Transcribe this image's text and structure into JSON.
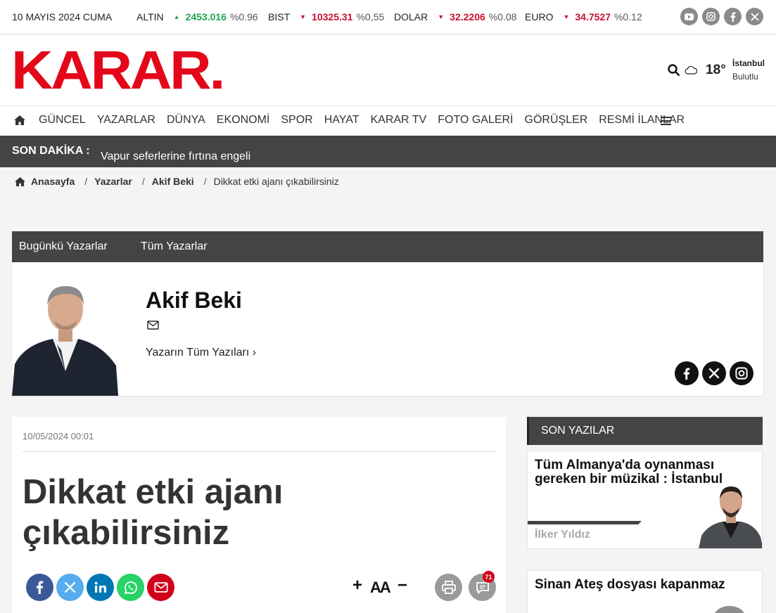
{
  "topbar": {
    "date": "10 MAYIS 2024 CUMA",
    "markets": [
      {
        "name": "ALTIN",
        "direction": "up",
        "value": "2453.016",
        "change": "%0.96"
      },
      {
        "name": "BIST",
        "direction": "down",
        "value": "10325.31",
        "change": "%0,55"
      },
      {
        "name": "DOLAR",
        "direction": "down",
        "value": "32.2206",
        "change": "%0.08"
      },
      {
        "name": "EURO",
        "direction": "down",
        "value": "34.7527",
        "change": "%0.12"
      }
    ],
    "social_icons": [
      "youtube-icon",
      "instagram-icon",
      "facebook-icon",
      "x-icon"
    ],
    "up_color": "#1fa64a",
    "down_color": "#c8102e"
  },
  "header": {
    "logo": "KARAR.",
    "brand_color": "#e4071a",
    "weather": {
      "temp": "18°",
      "city": "İstanbul",
      "condition": "Bulutlu"
    }
  },
  "nav": {
    "items": [
      "GÜNCEL",
      "YAZARLAR",
      "DÜNYA",
      "EKONOMİ",
      "SPOR",
      "HAYAT",
      "KARAR TV",
      "FOTO GALERİ",
      "GÖRÜŞLER",
      "RESMİ İLANLAR"
    ]
  },
  "breaking": {
    "label": "SON DAKİKA :",
    "text": "Vapur seferlerine fırtına engeli"
  },
  "breadcrumb": {
    "home": "Anasayfa",
    "section": "Yazarlar",
    "author": "Akif Beki",
    "current": "Dikkat etki ajanı çıkabilirsiniz"
  },
  "author_box": {
    "tabs": [
      "Bugünkü Yazarlar",
      "Tüm Yazarlar"
    ],
    "name": "Akif Beki",
    "all_posts": "Yazarın Tüm Yazıları ›"
  },
  "article": {
    "date": "10/05/2024 00:01",
    "title": "Dikkat etki ajanı çıkabilirsiniz",
    "font_controls": {
      "plus": "+",
      "aa": "AA",
      "minus": "−"
    },
    "comment_count": "71"
  },
  "sidebar": {
    "heading": "SON YAZILAR",
    "cards": [
      {
        "title": "Tüm Almanya'da oynanması gereken bir müzikal : İstanbul",
        "author": "İlker Yıldız"
      },
      {
        "title": "Sinan Ateş dosyası kapanmaz",
        "author": ""
      }
    ]
  }
}
